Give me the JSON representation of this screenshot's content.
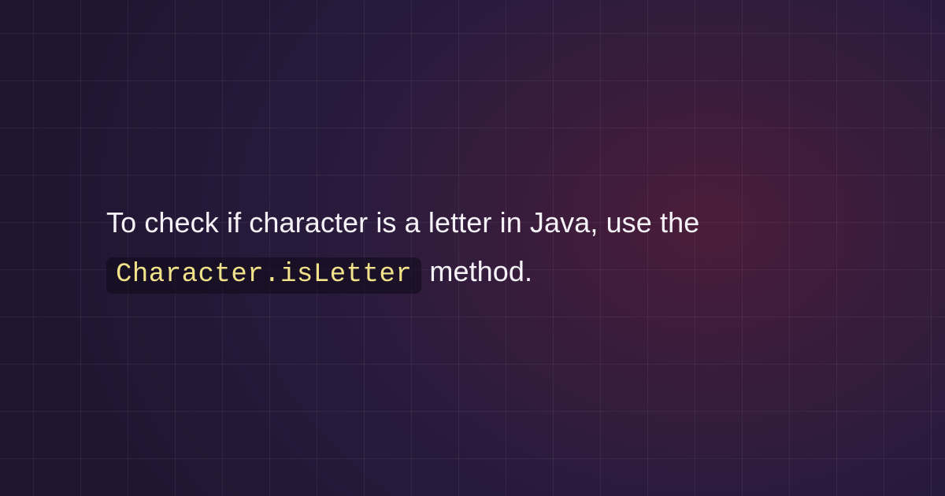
{
  "text": {
    "part1": "To check if character is a letter in Java, use the ",
    "code": "Character.isLetter",
    "part2": " method."
  }
}
